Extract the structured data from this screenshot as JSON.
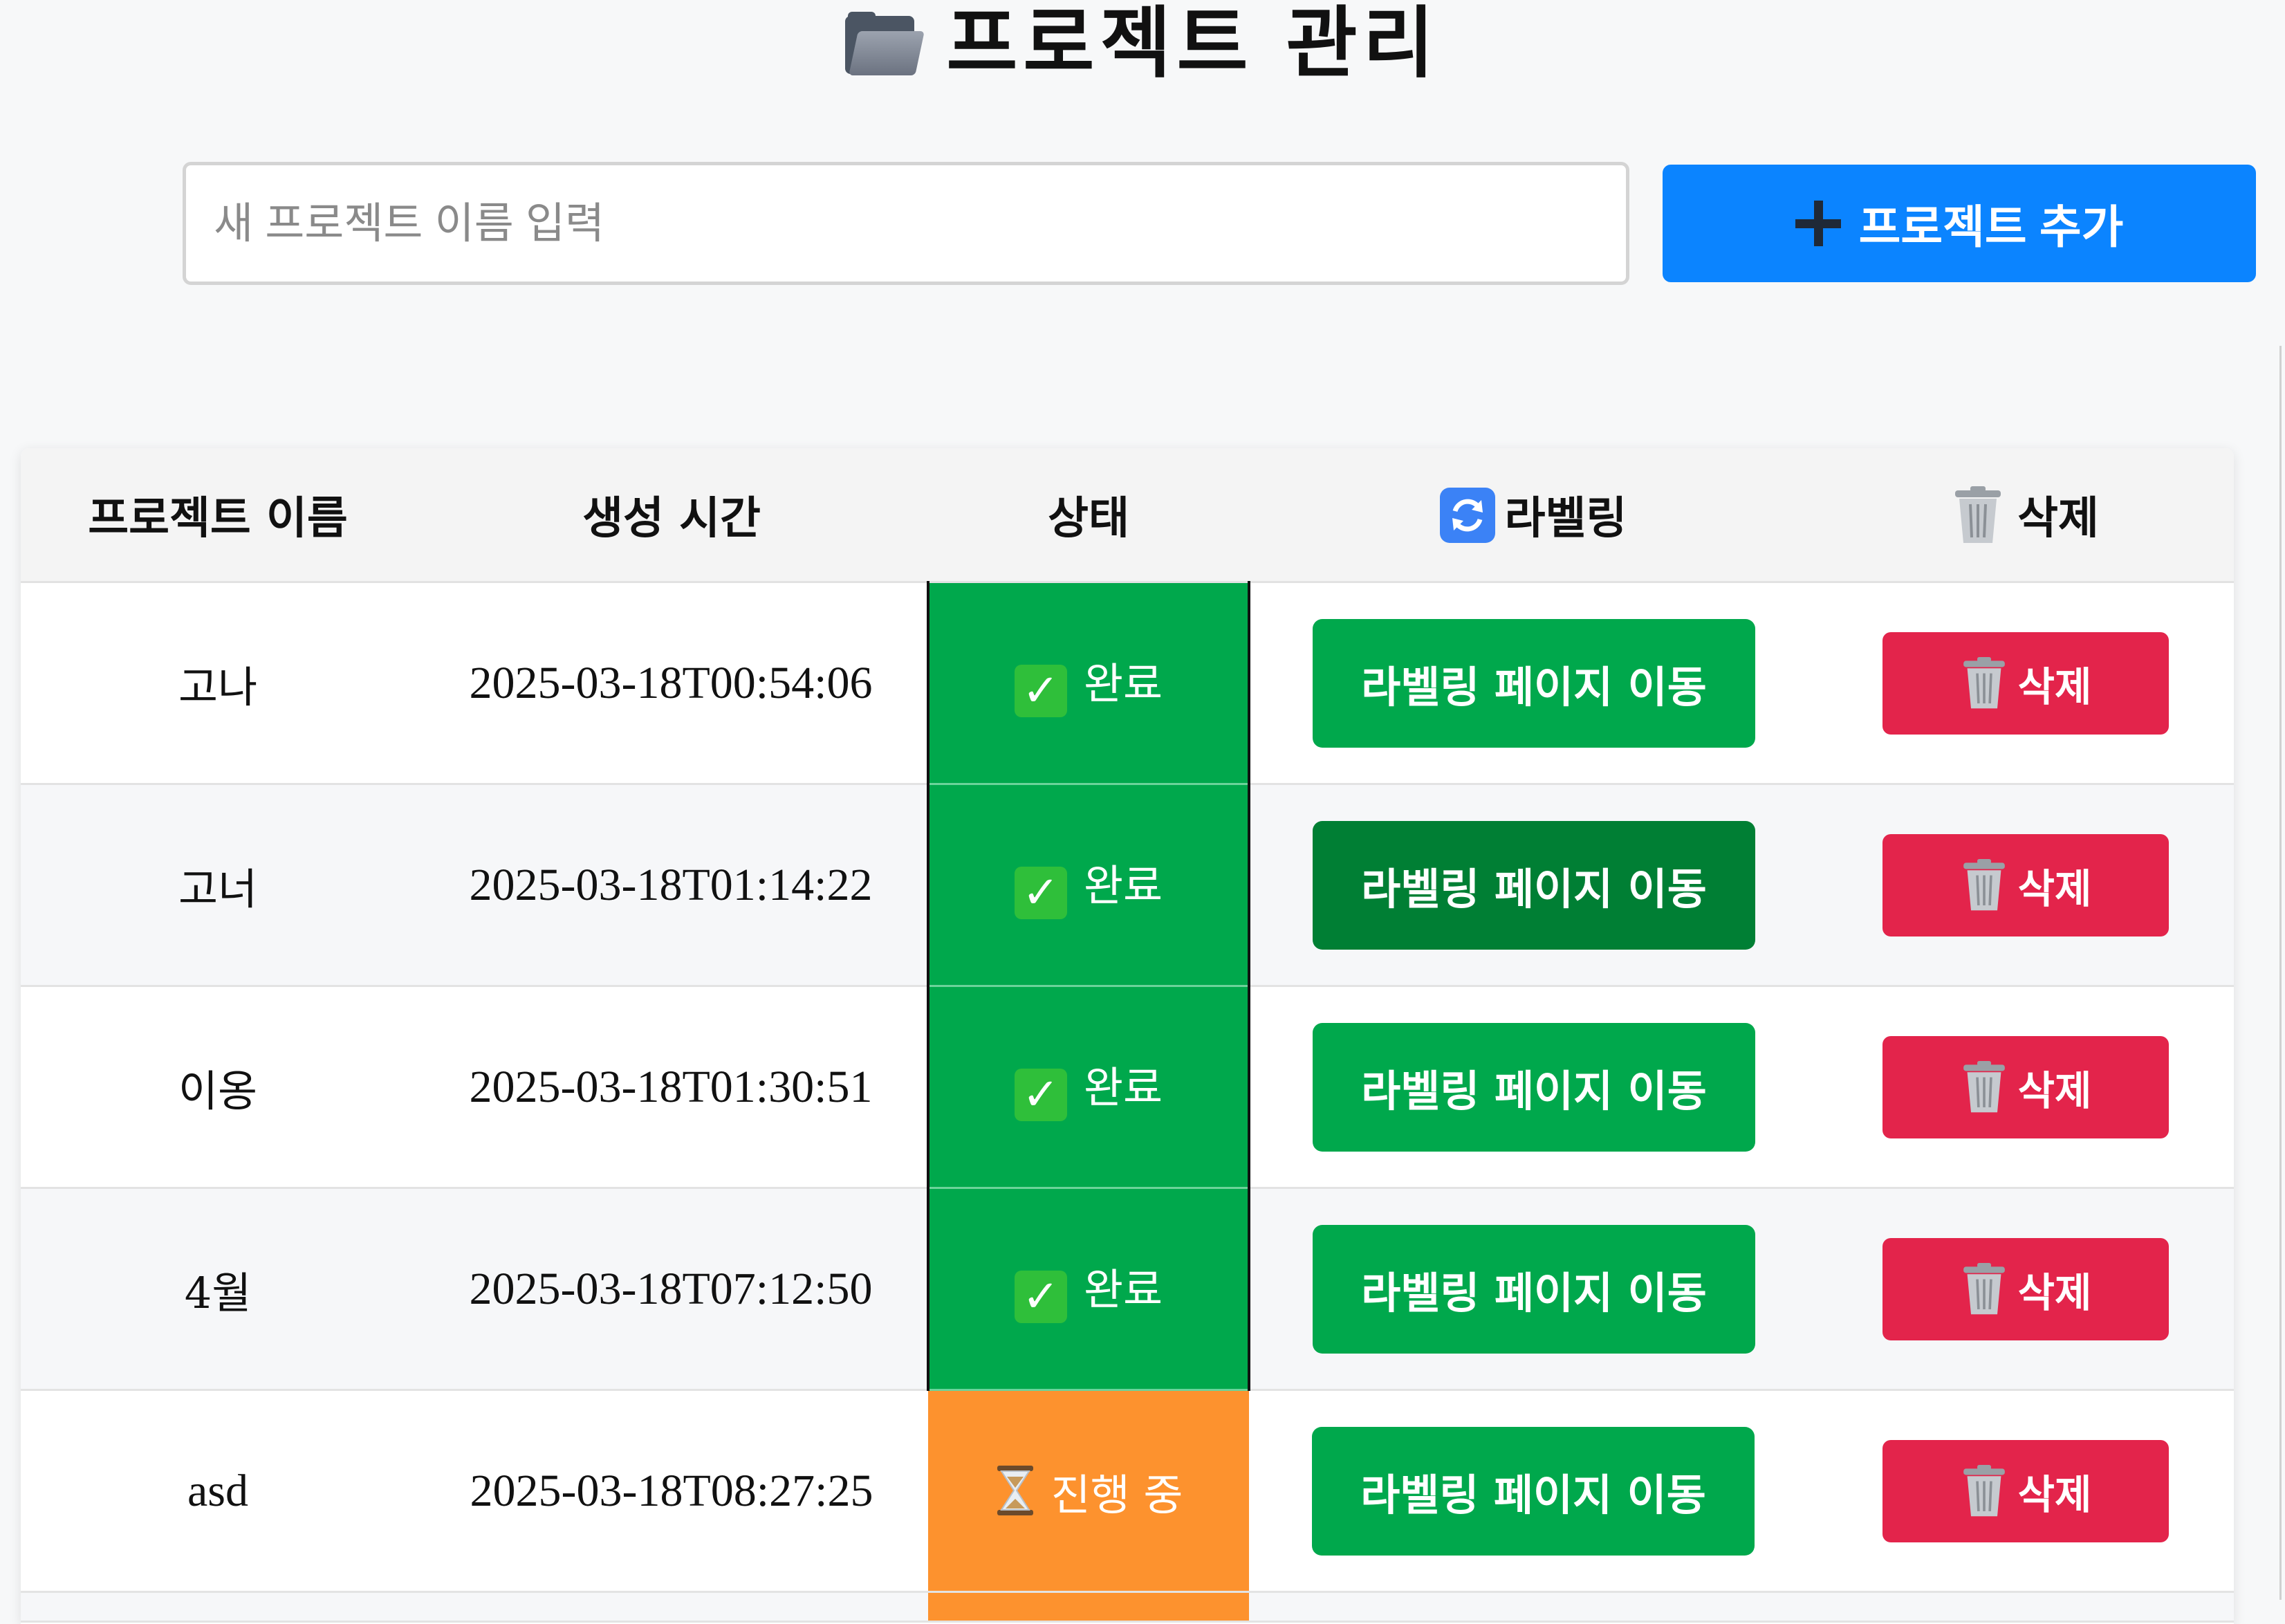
{
  "page": {
    "title": "프로젝트 관리",
    "title_icon": "folder-icon"
  },
  "add_project": {
    "placeholder": "새 프로젝트 이름 입력",
    "value": "",
    "button_label": "프로젝트 추가",
    "button_icon": "plus-icon",
    "button_color": "#0b84ff"
  },
  "table": {
    "headers": {
      "name": "프로젝트 이름",
      "created": "생성 시간",
      "status": "상태",
      "labeling": "라벨링",
      "labeling_icon": "refresh-icon",
      "delete": "삭제",
      "delete_icon": "trash-icon"
    },
    "rows": [
      {
        "name": "고나",
        "created": "2025-03-18T00:54:06",
        "status": "완료",
        "status_kind": "done",
        "labeling_button": "라벨링 페이지 이동",
        "delete_button": "삭제"
      },
      {
        "name": "고너",
        "created": "2025-03-18T01:14:22",
        "status": "완료",
        "status_kind": "done",
        "labeling_button": "라벨링 페이지 이동",
        "delete_button": "삭제"
      },
      {
        "name": "이옹",
        "created": "2025-03-18T01:30:51",
        "status": "완료",
        "status_kind": "done",
        "labeling_button": "라벨링 페이지 이동",
        "delete_button": "삭제"
      },
      {
        "name": "4월",
        "created": "2025-03-18T07:12:50",
        "status": "완료",
        "status_kind": "done",
        "labeling_button": "라벨링 페이지 이동",
        "delete_button": "삭제"
      },
      {
        "name": "asd",
        "created": "2025-03-18T08:27:25",
        "status": "진행 중",
        "status_kind": "in-progress",
        "labeling_button": "라벨링 페이지 이동",
        "delete_button": "삭제"
      }
    ]
  },
  "colors": {
    "status_done": "#00a84c",
    "status_in_progress": "#fd922e",
    "labeling_button": "#00a84c",
    "labeling_button_hover": "#007f34",
    "delete_button": "#e3244b"
  }
}
